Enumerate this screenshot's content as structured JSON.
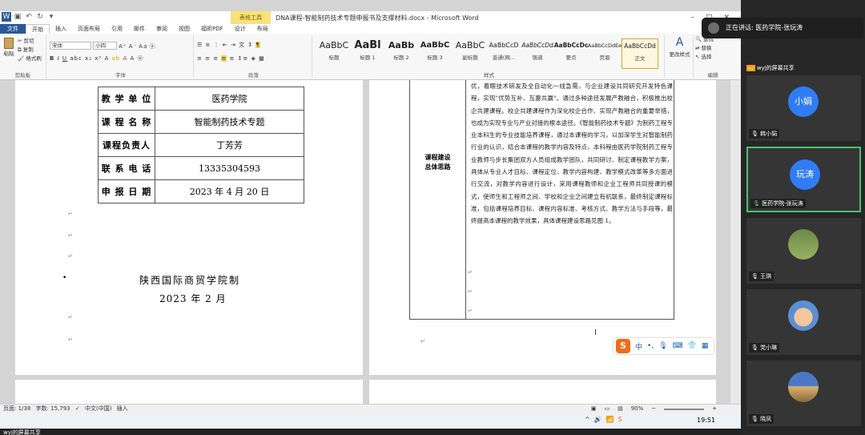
{
  "titlebar": {
    "context_group": "表格工具",
    "doc_title": "DNA课程-智能制药技术专题申报书及支撑材料.docx - Microsoft Word"
  },
  "tabs": [
    "文件",
    "开始",
    "插入",
    "页面布局",
    "引用",
    "邮件",
    "审阅",
    "视图",
    "福昕PDF",
    "设计",
    "布局"
  ],
  "ribbon": {
    "clipboard": {
      "paste": "粘贴",
      "cut": "剪切",
      "copy": "复制",
      "format_painter": "格式刷",
      "label": "剪贴板"
    },
    "font": {
      "name": "宋体",
      "size": "小四",
      "label": "字体"
    },
    "paragraph": {
      "label": "段落"
    },
    "styles": {
      "items": [
        {
          "sample": "AaBbC",
          "name": "标题"
        },
        {
          "sample": "AaBl",
          "name": "标题 1"
        },
        {
          "sample": "AaBb",
          "name": "标题 2"
        },
        {
          "sample": "AaBbC",
          "name": "标题 3"
        },
        {
          "sample": "AaBbC",
          "name": "副标题"
        },
        {
          "sample": "AaBbCcD",
          "name": "普通(网..."
        },
        {
          "sample": "AaBbCcDd",
          "name": "强调"
        },
        {
          "sample": "AaBbCcDc",
          "name": "要点"
        },
        {
          "sample": "AaBbCcDdEe",
          "name": "页眉"
        },
        {
          "sample": "AaBbCcDd",
          "name": "正文"
        }
      ],
      "change": "更改样式",
      "label": "样式"
    },
    "editing": {
      "find": "查找",
      "replace": "替换",
      "select": "选择",
      "label": "编辑"
    }
  },
  "left_page": {
    "table": [
      {
        "key": "教 学 单 位",
        "value": "医药学院"
      },
      {
        "key": "课 程 名 称",
        "value": "智能制药技术专题"
      },
      {
        "key": "课程负责人",
        "value": "丁芳芳"
      },
      {
        "key": "联 系 电 话",
        "value": "13335304593"
      },
      {
        "key": "申 报 日 期",
        "value": "2023 年 4 月 20 日"
      }
    ],
    "school": "陕西国际商贸学院制",
    "date": "2023 年 2 月"
  },
  "right_page": {
    "cell_label_1": "课程建设",
    "cell_label_2": "总体思路",
    "cell_text": "优，着眼技术研发及全自动化一线急需，与企业建设共同研究开发特色课程，实现\"优势互补、互惠共赢\"。通过多种途径发展产教融合，积极推出校企共建课程。校企共建课程作为深化校企合作、实现产教融合的重要举措，也成为实现专业与产业对接的根本途径。《智能制药技术专题》为制药工程专业本科生的专业技能培养课程，通过本课程的学习，以加深学生对智能制药行业的认识，结合本课程的教学内容及特点，本科程由医药学院制药工程专业教师与步长集团双方人员组成教学团队，共同研讨、制定课程教学方案，具体从专业人才目标、课程定位、教学内容构建、教学模式改革等多方面进行交流，对教学内容进行设计，采用课程教师和企业工程师共同授课的模式，使师生和工程师之间、学校和企业之间建立有机联系，最终制定课程标准，包括课程培养目标、课程内容标准、考核方式、教学方法与手段等，最终提高本课程的教学效果，具体课程建设思路见图 1。"
  },
  "ime": {
    "lang": "中"
  },
  "statusbar": {
    "page": "页面: 1/38",
    "words": "字数: 15,793",
    "lang": "中文(中国)",
    "mode": "插入",
    "zoom": "90%"
  },
  "taskbar": {
    "time": "19:51"
  },
  "bottom": {
    "label": "wyj的屏幕共享"
  },
  "meeting": {
    "speaking_prefix": "正在讲话: ",
    "speaking_name": "医药学院-张玩涛",
    "share_label": "wyj的屏幕共享",
    "participants": [
      {
        "avatar": "小娟",
        "name": "韩小娟",
        "type": "circle"
      },
      {
        "avatar": "玩涛",
        "name": "医药学院-张玩涛",
        "type": "circle"
      },
      {
        "avatar": "",
        "name": "王琪",
        "type": "photo"
      },
      {
        "avatar": "",
        "name": "党小琳",
        "type": "photo"
      },
      {
        "avatar": "",
        "name": "晓凤",
        "type": "photo"
      }
    ]
  }
}
